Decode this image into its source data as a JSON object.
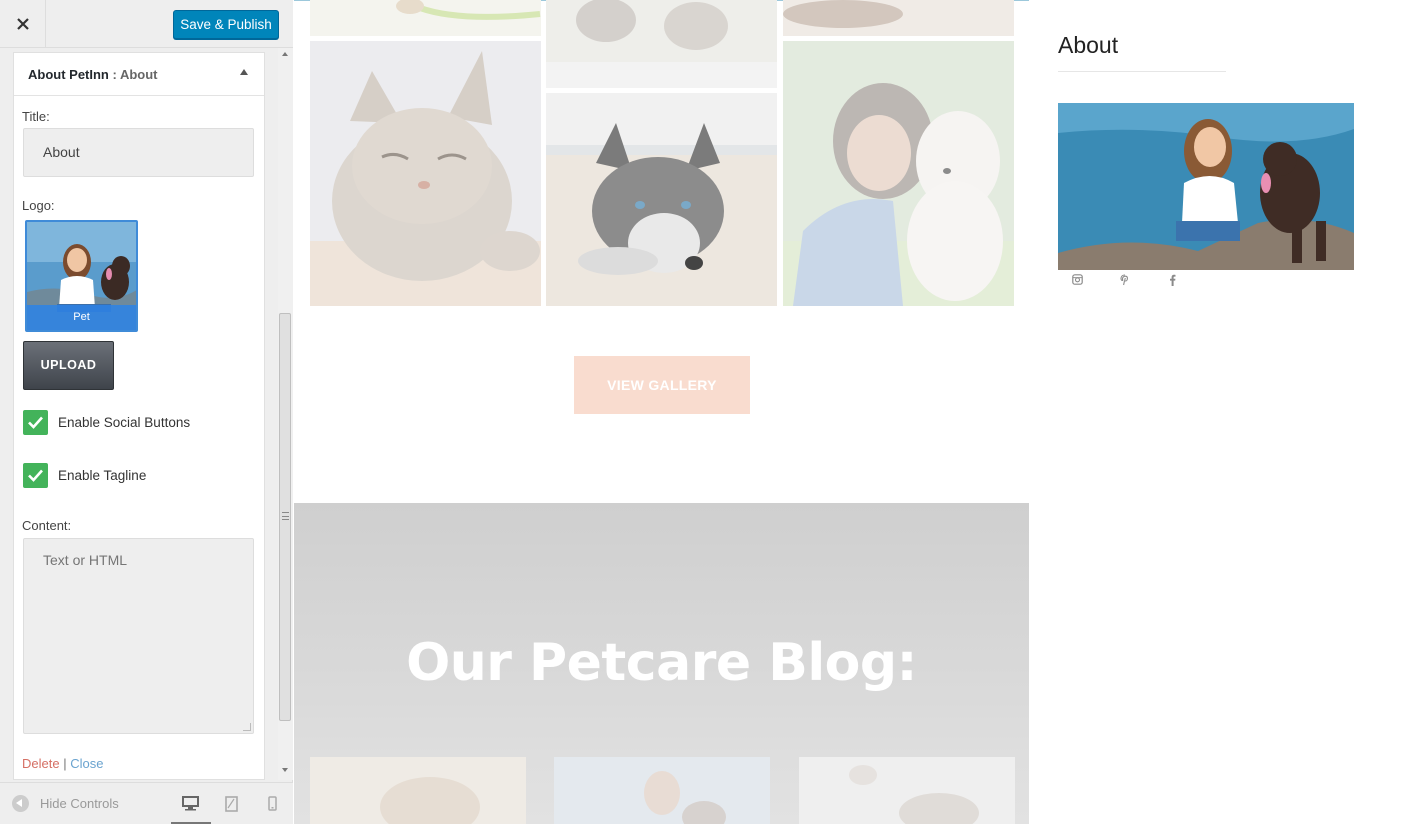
{
  "header": {
    "close_icon": "close-icon",
    "publish_label": "Save & Publish"
  },
  "widget": {
    "name": "About PetInn",
    "separator": " : ",
    "subtitle": "About",
    "title_label": "Title:",
    "title_value": "About",
    "logo_label": "Logo:",
    "logo_caption": "Pet",
    "upload_label": "UPLOAD",
    "social_label": "Enable Social Buttons",
    "social_checked": true,
    "tagline_label": "Enable Tagline",
    "tagline_checked": true,
    "content_label": "Content:",
    "content_placeholder": "Text or HTML",
    "content_value": "",
    "delete_label": "Delete",
    "actions_separator": " | ",
    "close_label": "Close"
  },
  "footer": {
    "hide_label": "Hide Controls",
    "devices": [
      "desktop-icon",
      "tablet-icon",
      "mobile-icon"
    ],
    "active_device": "desktop"
  },
  "preview": {
    "gallery_button": "VIEW GALLERY",
    "blog_title": "Our Petcare Blog:",
    "sidebar_title": "About",
    "social_icons": [
      "instagram-icon",
      "pinterest-icon",
      "facebook-icon"
    ]
  },
  "colors": {
    "publish": "#0085ba",
    "check": "#43b35a",
    "delete_link": "#d56f64",
    "close_link": "#6aa3cf",
    "gallery_button": "#f9dccf"
  }
}
